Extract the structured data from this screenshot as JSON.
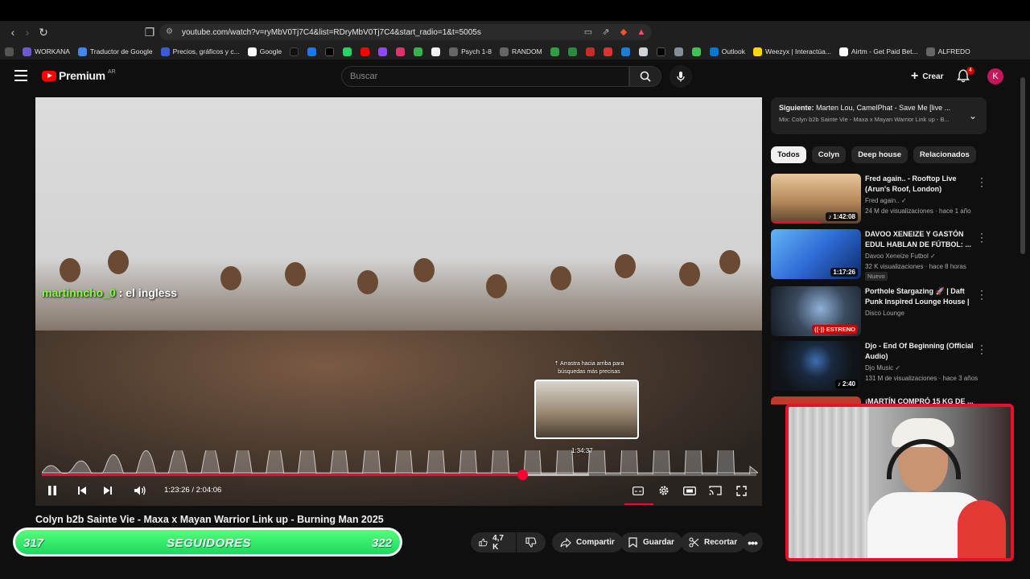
{
  "browser": {
    "url": "youtube.com/watch?v=ryMbV0Tj7C4&list=RDryMbV0Tj7C4&start_radio=1&t=5005s",
    "bookmarks": [
      {
        "label": "WORKANA",
        "color": "#6a5acd"
      },
      {
        "label": "Traductor de Google",
        "color": "#4285f4"
      },
      {
        "label": "Precios, gráficos y c...",
        "color": "#3b5bdb"
      },
      {
        "label": "Google",
        "color": "#ffffff"
      },
      {
        "label": "Psych 1-8",
        "color": "#666666"
      },
      {
        "label": "RANDOM",
        "color": "#666666"
      },
      {
        "label": "Outlook",
        "color": "#0078d4"
      },
      {
        "label": "Weezyx | Interactúa...",
        "color": "#ffd700"
      },
      {
        "label": "Airtm - Get Paid Bet...",
        "color": "#ffffff"
      },
      {
        "label": "ALFREDO",
        "color": "#666666"
      }
    ]
  },
  "header": {
    "logo_text": "Premium",
    "country": "AR",
    "search_placeholder": "Buscar",
    "create_label": "Crear",
    "notifications_count": "4",
    "avatar_letter": "K"
  },
  "player": {
    "chat_nick": "martinncho_0",
    "chat_message": ": el ingless",
    "hint_text": "⇡ Arrastra hacia arriba para búsquedas más precisas",
    "preview_time": "1:34:37",
    "current_time": "1:23:26",
    "duration": "2:04:06",
    "time_display": "1:23:26 / 2:04:06",
    "progress_fraction": 0.672
  },
  "video": {
    "title": "Colyn b2b Sainte Vie - Maxa x Mayan Warrior Link up - Burning Man 2025",
    "likes": "4,7 K",
    "share_label": "Compartir",
    "save_label": "Guardar",
    "clip_label": "Recortar"
  },
  "followers": {
    "start": "317",
    "label": "SEGUIDORES",
    "end": "322",
    "fraction": 1.0
  },
  "sidebar": {
    "upnext_prefix": "Siguiente:",
    "upnext_title": "Marten Lou, CamelPhat - Save Me [live ...",
    "upnext_mix": "Mix: Colyn b2b Sainte Vie - Maxa x Mayan Warrior Link up - B...",
    "chips": [
      "Todos",
      "Colyn",
      "Deep house",
      "Relacionados"
    ],
    "items": [
      {
        "title": "Fred again.. - Rooftop Live (Arun's Roof, London)",
        "channel": "Fred again.. ✓",
        "meta": "24 M de visualizaciones · hace 1 año",
        "duration": "♪ 1:42:08",
        "thumb": "#b58a5a",
        "progress": 0.55
      },
      {
        "title": "DAVOO XENEIZE Y GASTÓN EDUL HABLAN DE FÚTBOL: ...",
        "channel": "Davoo Xeneize Futbol ✓",
        "meta": "32 K visualizaciones · hace 8 horas",
        "duration": "1:17:26",
        "badge": "Nuevo",
        "thumb": "#2e6bd6",
        "progress": 0
      },
      {
        "title": "Porthole Stargazing 🚀 | Daft Punk Inspired Lounge House | ...",
        "channel": "Disco Lounge",
        "meta": "",
        "duration": "((·)) ESTRENO",
        "thumb": "#3a4a5e",
        "progress": 0
      },
      {
        "title": "Djo - End Of Beginning (Official Audio)",
        "channel": "Djo Music ✓",
        "meta": "131 M de visualizaciones · hace 3 años",
        "duration": "♪ 2:40",
        "thumb": "#101418",
        "progress": 0
      },
      {
        "title": "¡MARTÍN COMPRÓ 15 KG DE ...",
        "channel": "",
        "meta": "",
        "duration": "",
        "thumb": "#c0392b",
        "progress": 0
      }
    ]
  },
  "colors": {
    "accent": "#ff0033",
    "brand_red": "#ff0000",
    "follower_green": "#1ed75f",
    "webcam_border": "#e8102a"
  }
}
